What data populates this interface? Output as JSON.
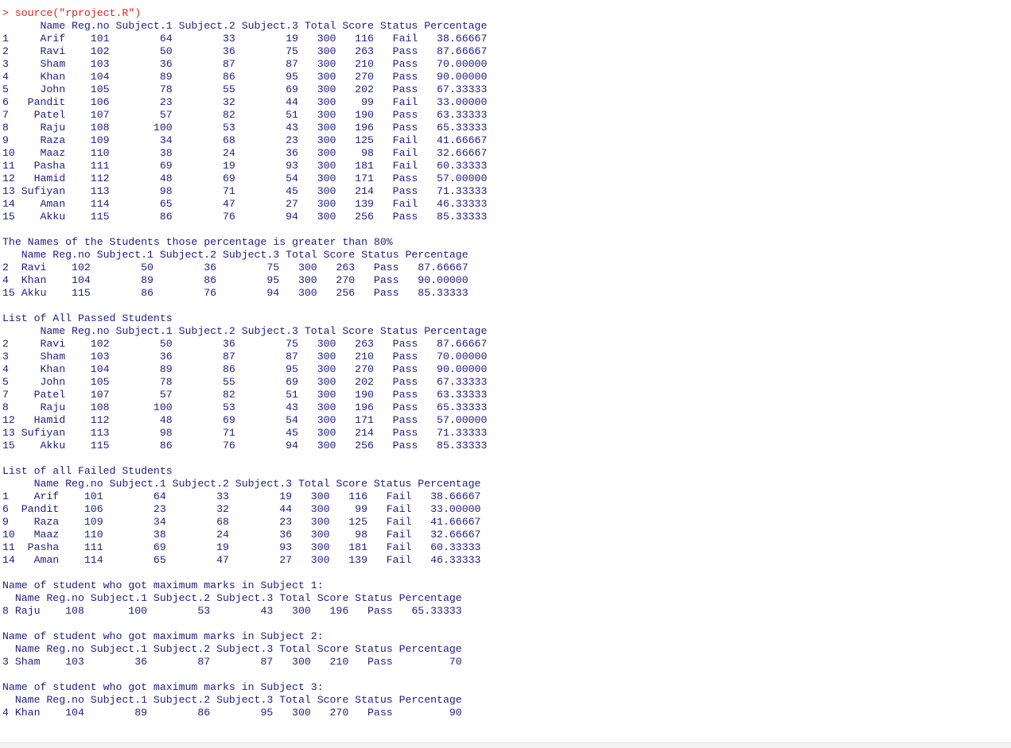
{
  "colors": {
    "output_text": "#1d1d82",
    "command_text": "#e0201c",
    "background": "#ffffff"
  },
  "console": {
    "lines": [
      {
        "type": "cmd",
        "text": "> source(\"rproject.R\")"
      },
      {
        "type": "out",
        "text": "      Name Reg.no Subject.1 Subject.2 Subject.3 Total Score Status Percentage"
      },
      {
        "type": "out",
        "text": "1     Arif    101        64        33        19   300   116   Fail   38.66667"
      },
      {
        "type": "out",
        "text": "2     Ravi    102        50        36        75   300   263   Pass   87.66667"
      },
      {
        "type": "out",
        "text": "3     Sham    103        36        87        87   300   210   Pass   70.00000"
      },
      {
        "type": "out",
        "text": "4     Khan    104        89        86        95   300   270   Pass   90.00000"
      },
      {
        "type": "out",
        "text": "5     John    105        78        55        69   300   202   Pass   67.33333"
      },
      {
        "type": "out",
        "text": "6   Pandit    106        23        32        44   300    99   Fail   33.00000"
      },
      {
        "type": "out",
        "text": "7    Patel    107        57        82        51   300   190   Pass   63.33333"
      },
      {
        "type": "out",
        "text": "8     Raju    108       100        53        43   300   196   Pass   65.33333"
      },
      {
        "type": "out",
        "text": "9     Raza    109        34        68        23   300   125   Fail   41.66667"
      },
      {
        "type": "out",
        "text": "10    Maaz    110        38        24        36   300    98   Fail   32.66667"
      },
      {
        "type": "out",
        "text": "11   Pasha    111        69        19        93   300   181   Fail   60.33333"
      },
      {
        "type": "out",
        "text": "12   Hamid    112        48        69        54   300   171   Pass   57.00000"
      },
      {
        "type": "out",
        "text": "13 Sufiyan    113        98        71        45   300   214   Pass   71.33333"
      },
      {
        "type": "out",
        "text": "14    Aman    114        65        47        27   300   139   Fail   46.33333"
      },
      {
        "type": "out",
        "text": "15    Akku    115        86        76        94   300   256   Pass   85.33333"
      },
      {
        "type": "blank",
        "text": ""
      },
      {
        "type": "out",
        "text": "The Names of the Students those percentage is greater than 80%"
      },
      {
        "type": "out",
        "text": "   Name Reg.no Subject.1 Subject.2 Subject.3 Total Score Status Percentage"
      },
      {
        "type": "out",
        "text": "2  Ravi    102        50        36        75   300   263   Pass   87.66667"
      },
      {
        "type": "out",
        "text": "4  Khan    104        89        86        95   300   270   Pass   90.00000"
      },
      {
        "type": "out",
        "text": "15 Akku    115        86        76        94   300   256   Pass   85.33333"
      },
      {
        "type": "blank",
        "text": ""
      },
      {
        "type": "out",
        "text": "List of All Passed Students"
      },
      {
        "type": "out",
        "text": "      Name Reg.no Subject.1 Subject.2 Subject.3 Total Score Status Percentage"
      },
      {
        "type": "out",
        "text": "2     Ravi    102        50        36        75   300   263   Pass   87.66667"
      },
      {
        "type": "out",
        "text": "3     Sham    103        36        87        87   300   210   Pass   70.00000"
      },
      {
        "type": "out",
        "text": "4     Khan    104        89        86        95   300   270   Pass   90.00000"
      },
      {
        "type": "out",
        "text": "5     John    105        78        55        69   300   202   Pass   67.33333"
      },
      {
        "type": "out",
        "text": "7    Patel    107        57        82        51   300   190   Pass   63.33333"
      },
      {
        "type": "out",
        "text": "8     Raju    108       100        53        43   300   196   Pass   65.33333"
      },
      {
        "type": "out",
        "text": "12   Hamid    112        48        69        54   300   171   Pass   57.00000"
      },
      {
        "type": "out",
        "text": "13 Sufiyan    113        98        71        45   300   214   Pass   71.33333"
      },
      {
        "type": "out",
        "text": "15    Akku    115        86        76        94   300   256   Pass   85.33333"
      },
      {
        "type": "blank",
        "text": ""
      },
      {
        "type": "out",
        "text": "List of all Failed Students"
      },
      {
        "type": "out",
        "text": "     Name Reg.no Subject.1 Subject.2 Subject.3 Total Score Status Percentage"
      },
      {
        "type": "out",
        "text": "1    Arif    101        64        33        19   300   116   Fail   38.66667"
      },
      {
        "type": "out",
        "text": "6  Pandit    106        23        32        44   300    99   Fail   33.00000"
      },
      {
        "type": "out",
        "text": "9    Raza    109        34        68        23   300   125   Fail   41.66667"
      },
      {
        "type": "out",
        "text": "10   Maaz    110        38        24        36   300    98   Fail   32.66667"
      },
      {
        "type": "out",
        "text": "11  Pasha    111        69        19        93   300   181   Fail   60.33333"
      },
      {
        "type": "out",
        "text": "14   Aman    114        65        47        27   300   139   Fail   46.33333"
      },
      {
        "type": "blank",
        "text": ""
      },
      {
        "type": "out",
        "text": "Name of student who got maximum marks in Subject 1:"
      },
      {
        "type": "out",
        "text": "  Name Reg.no Subject.1 Subject.2 Subject.3 Total Score Status Percentage"
      },
      {
        "type": "out",
        "text": "8 Raju    108       100        53        43   300   196   Pass   65.33333"
      },
      {
        "type": "blank",
        "text": ""
      },
      {
        "type": "out",
        "text": "Name of student who got maximum marks in Subject 2:"
      },
      {
        "type": "out",
        "text": "  Name Reg.no Subject.1 Subject.2 Subject.3 Total Score Status Percentage"
      },
      {
        "type": "out",
        "text": "3 Sham    103        36        87        87   300   210   Pass         70"
      },
      {
        "type": "blank",
        "text": ""
      },
      {
        "type": "out",
        "text": "Name of student who got maximum marks in Subject 3:"
      },
      {
        "type": "out",
        "text": "  Name Reg.no Subject.1 Subject.2 Subject.3 Total Score Status Percentage"
      },
      {
        "type": "out",
        "text": "4 Khan    104        89        86        95   300   270   Pass         90"
      }
    ]
  }
}
